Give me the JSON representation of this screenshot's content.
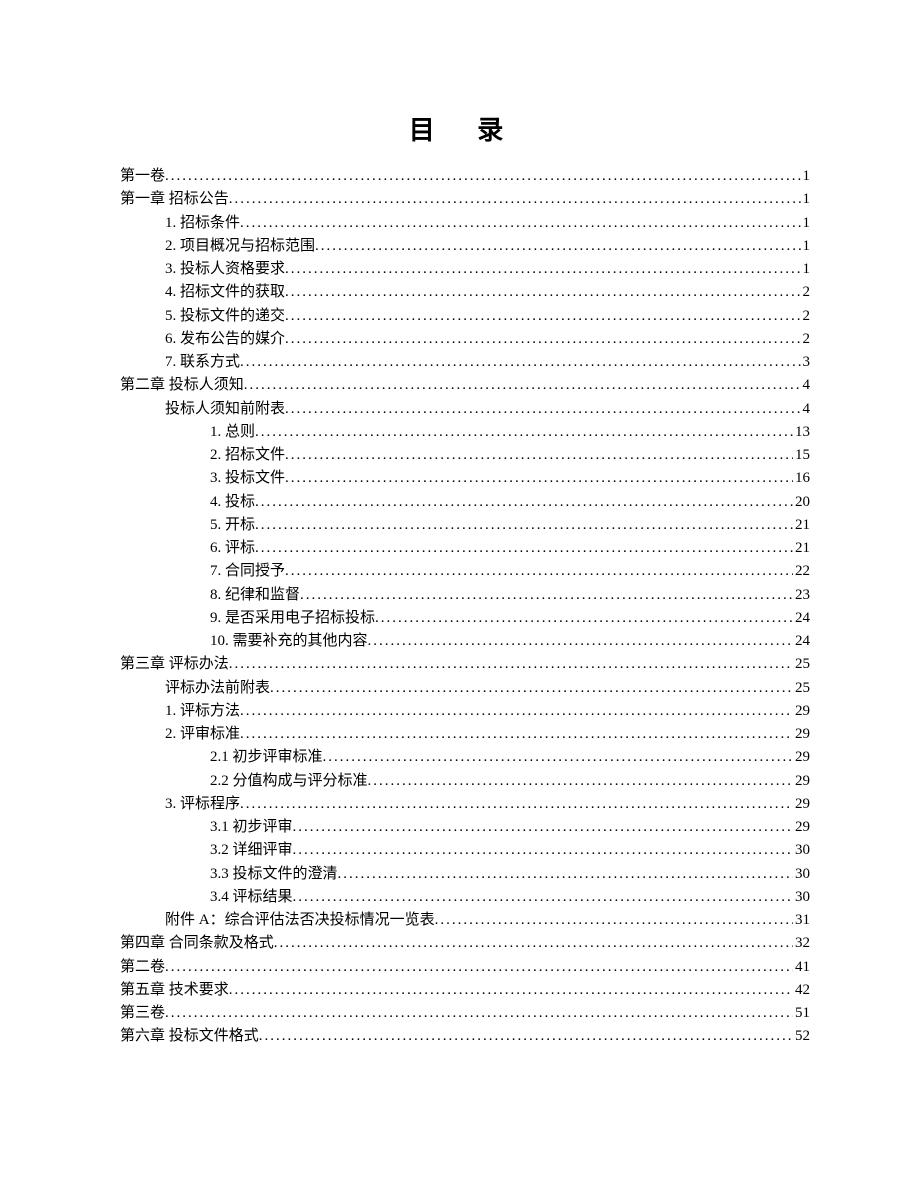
{
  "title": "目 录",
  "entries": [
    {
      "indent": 0,
      "label": "第一卷",
      "page": "1"
    },
    {
      "indent": 0,
      "label": "第一章  招标公告",
      "page": "1"
    },
    {
      "indent": 1,
      "label": "1. 招标条件",
      "page": "1"
    },
    {
      "indent": 1,
      "label": "2. 项目概况与招标范围",
      "page": "1"
    },
    {
      "indent": 1,
      "label": "3. 投标人资格要求",
      "page": "1"
    },
    {
      "indent": 1,
      "label": "4. 招标文件的获取",
      "page": "2"
    },
    {
      "indent": 1,
      "label": "5. 投标文件的递交",
      "page": "2"
    },
    {
      "indent": 1,
      "label": "6. 发布公告的媒介",
      "page": "2"
    },
    {
      "indent": 1,
      "label": "7. 联系方式",
      "page": "3"
    },
    {
      "indent": 0,
      "label": "第二章  投标人须知",
      "page": "4"
    },
    {
      "indent": 1,
      "label": "投标人须知前附表",
      "page": "4"
    },
    {
      "indent": 2,
      "label": "1. 总则",
      "page": "13"
    },
    {
      "indent": 2,
      "label": "2. 招标文件",
      "page": "15"
    },
    {
      "indent": 2,
      "label": "3. 投标文件",
      "page": "16"
    },
    {
      "indent": 2,
      "label": "4. 投标",
      "page": "20"
    },
    {
      "indent": 2,
      "label": "5. 开标",
      "page": "21"
    },
    {
      "indent": 2,
      "label": "6. 评标",
      "page": "21"
    },
    {
      "indent": 2,
      "label": "7. 合同授予",
      "page": "22"
    },
    {
      "indent": 2,
      "label": "8. 纪律和监督",
      "page": "23"
    },
    {
      "indent": 2,
      "label": "9. 是否采用电子招标投标",
      "page": "24"
    },
    {
      "indent": 2,
      "label": "10. 需要补充的其他内容",
      "page": "24"
    },
    {
      "indent": 0,
      "label": "第三章  评标办法",
      "page": "25"
    },
    {
      "indent": 1,
      "label": "评标办法前附表",
      "page": "25"
    },
    {
      "indent": 1,
      "label": "1.  评标方法",
      "page": "29"
    },
    {
      "indent": 1,
      "label": "2.  评审标准",
      "page": "29"
    },
    {
      "indent": 2,
      "label": "2.1  初步评审标准",
      "page": "29"
    },
    {
      "indent": 2,
      "label": "2.2  分值构成与评分标准",
      "page": "29"
    },
    {
      "indent": 1,
      "label": "3.  评标程序",
      "page": "29"
    },
    {
      "indent": 2,
      "label": "3.1 初步评审",
      "page": "29"
    },
    {
      "indent": 2,
      "label": "3.2 详细评审",
      "page": "30"
    },
    {
      "indent": 2,
      "label": "3.3 投标文件的澄清",
      "page": "30"
    },
    {
      "indent": 2,
      "label": "3.4 评标结果",
      "page": "30"
    },
    {
      "indent": 1,
      "label": "附件 A：综合评估法否决投标情况一览表",
      "page": "31"
    },
    {
      "indent": 0,
      "label": "第四章   合同条款及格式",
      "page": "32"
    },
    {
      "indent": 0,
      "label": "第二卷",
      "page": "41"
    },
    {
      "indent": 0,
      "label": "第五章 技术要求",
      "page": "42"
    },
    {
      "indent": 0,
      "label": "第三卷",
      "page": "51"
    },
    {
      "indent": 0,
      "label": "第六章 投标文件格式",
      "page": "52"
    }
  ]
}
